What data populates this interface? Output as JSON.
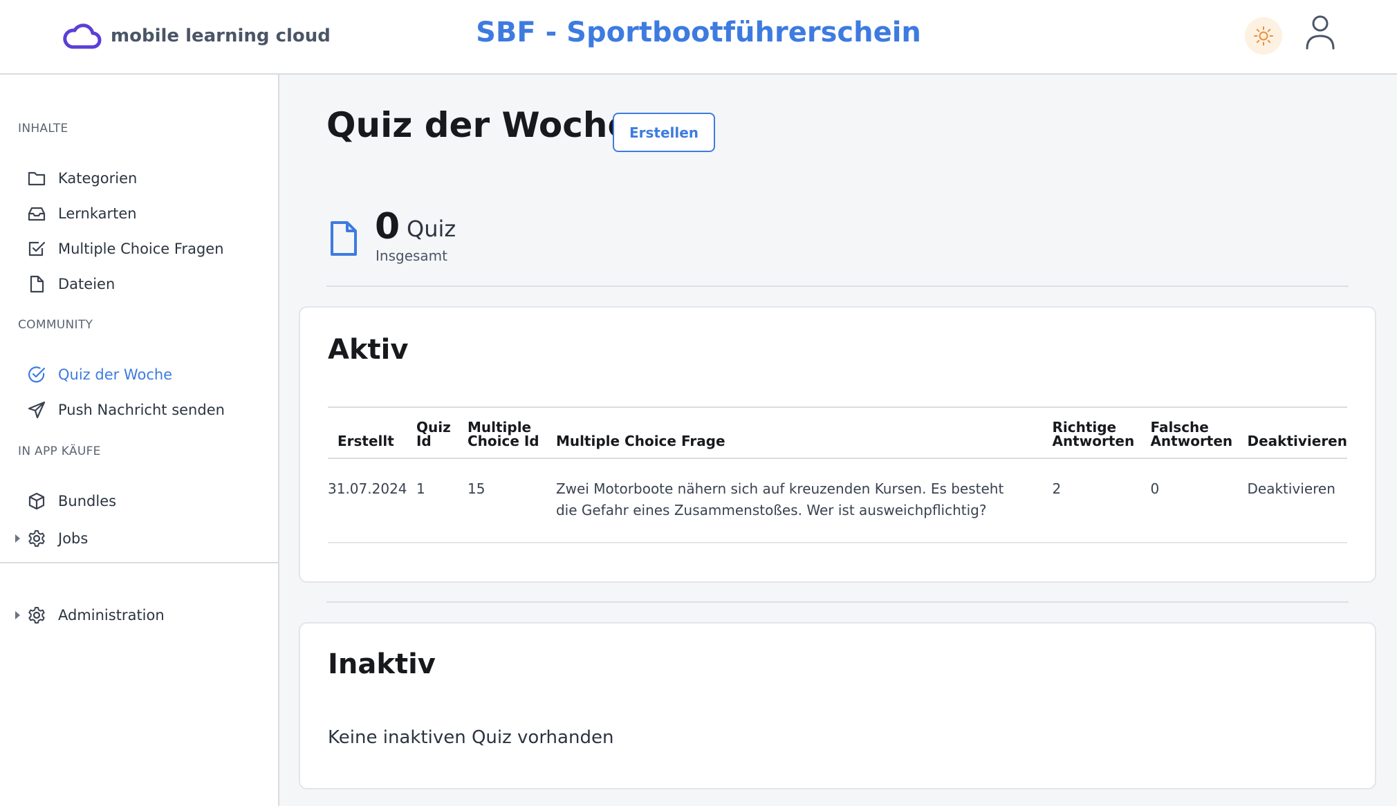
{
  "header": {
    "brand": "mobile learning cloud",
    "app_title": "SBF - Sportbootführerschein"
  },
  "sidebar": {
    "sections": [
      {
        "label": "INHALTE",
        "items": [
          {
            "label": "Kategorien",
            "icon": "folder-icon"
          },
          {
            "label": "Lernkarten",
            "icon": "inbox-icon"
          },
          {
            "label": "Multiple Choice Fragen",
            "icon": "checkbox-icon"
          },
          {
            "label": "Dateien",
            "icon": "file-icon"
          }
        ]
      },
      {
        "label": "COMMUNITY",
        "items": [
          {
            "label": "Quiz der Woche",
            "icon": "check-circle-icon",
            "active": true
          },
          {
            "label": "Push Nachricht senden",
            "icon": "send-icon"
          }
        ]
      },
      {
        "label": "IN APP KÄUFE",
        "items": [
          {
            "label": "Bundles",
            "icon": "cube-icon"
          },
          {
            "label": "Jobs",
            "icon": "gear-icon",
            "collapsible": true
          }
        ]
      }
    ],
    "footer_item": {
      "label": "Administration",
      "icon": "gear-icon",
      "collapsible": true
    }
  },
  "main": {
    "title": "Quiz der Woche",
    "create_label": "Erstellen",
    "stat": {
      "count": "0",
      "unit": "Quiz",
      "caption": "Insgesamt"
    },
    "active": {
      "title": "Aktiv",
      "columns": [
        "Erstellt",
        "Quiz Id",
        "Multiple Choice Id",
        "Multiple Choice Frage",
        "Richtige Antworten",
        "Falsche Antworten",
        "Deaktivieren"
      ],
      "rows": [
        {
          "created": "31.07.2024",
          "quiz_id": "1",
          "mc_id": "15",
          "question": "Zwei Motorboote nähern sich auf kreuzenden Kursen. Es besteht die Gefahr eines Zusammenstoßes. Wer ist ausweichpflichtig?",
          "correct": "2",
          "wrong": "0",
          "action": "Deaktivieren"
        }
      ]
    },
    "inactive": {
      "title": "Inaktiv",
      "empty_message": "Keine inaktiven Quiz vorhanden"
    }
  },
  "colors": {
    "accent": "#3d7be0",
    "brand_purple": "#5b3fd6",
    "sun": "#e8903a"
  }
}
